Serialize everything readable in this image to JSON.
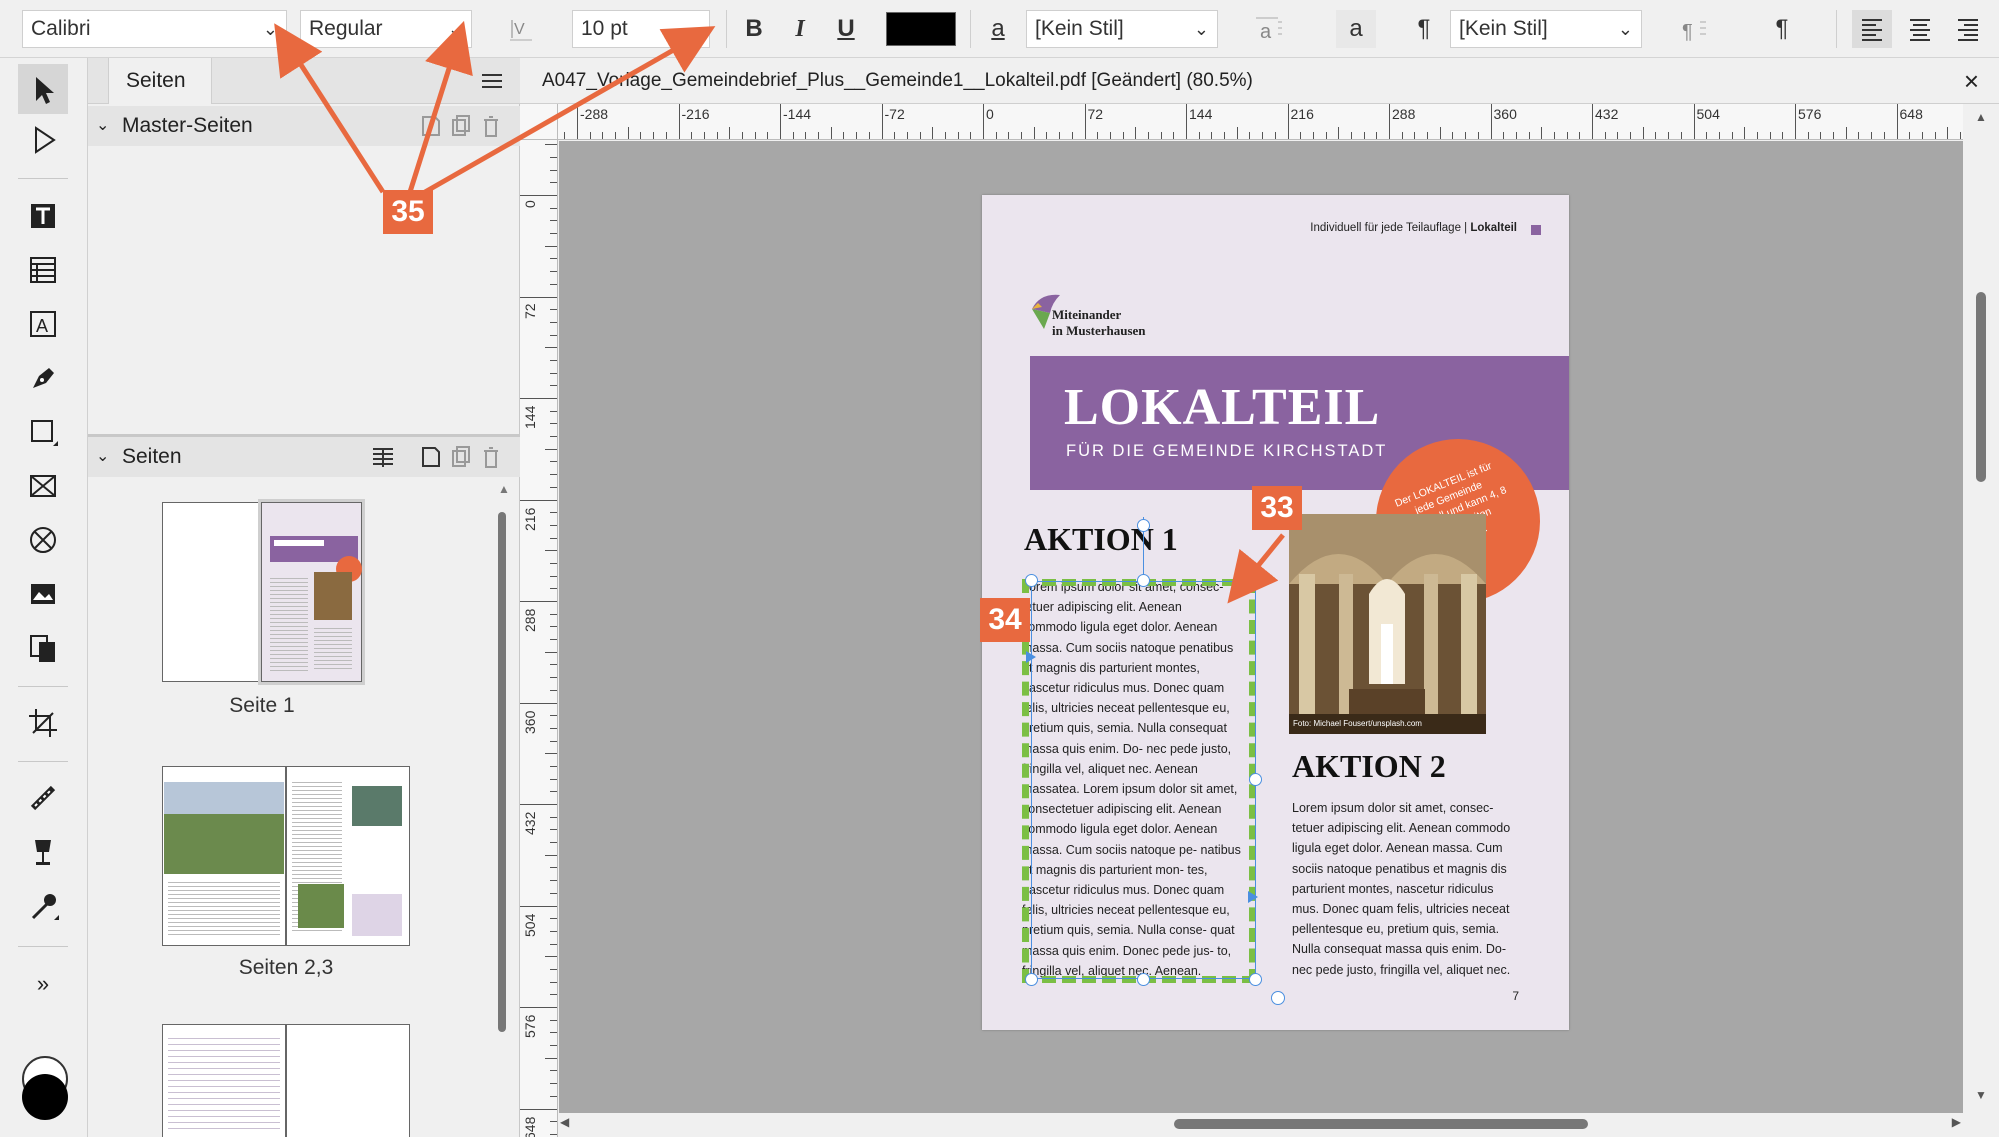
{
  "toolbar": {
    "font_family": "Calibri",
    "font_style": "Regular",
    "font_size": "10 pt",
    "bold": "B",
    "italic": "I",
    "underline": "U",
    "char_style_glyph": "a",
    "char_style": "[Kein Stil]",
    "para_style_glyph": "a",
    "pilcrow": "¶",
    "para_style": "[Kein Stil]",
    "text_color": "#000000"
  },
  "panel": {
    "tab_label": "Seiten",
    "master_section": "Master-Seiten",
    "pages_section": "Seiten",
    "thumbs": [
      {
        "label": "Seite 1"
      },
      {
        "label": "Seiten 2,3"
      }
    ]
  },
  "document": {
    "title": "A047_Vorlage_Gemeindebrief_Plus__Gemeinde1__Lokalteil.pdf [Geändert] (80.5%)",
    "close": "×"
  },
  "ruler": {
    "h_ticks": [
      "-288",
      "-216",
      "-144",
      "-72",
      "0",
      "72",
      "144",
      "216",
      "288",
      "360",
      "432",
      "504",
      "576",
      "648"
    ],
    "v_ticks": [
      "0",
      "72",
      "144",
      "216",
      "288",
      "360",
      "432",
      "504",
      "576",
      "648"
    ]
  },
  "page": {
    "header_text": "Individuell für jede Teilauflage | ",
    "header_bold": "Lokalteil",
    "logo_line1": "Miteinander",
    "logo_line2": "in Musterhausen",
    "banner_title": "LOKALTEIL",
    "banner_subtitle": "FÜR DIE GEMEINDE KIRCHSTADT",
    "circle_text": "Der LOKALTEIL ist für jede Gemeinde individuell und kann 4, 8 oder 12 Seiten umfassen.",
    "photo_credit": "Foto: Michael Fousert/unsplash.com",
    "aktion1_title": "AKTION 1",
    "aktion1_text": "Lorem ipsum dolor sit amet, consec-\ntetuer adipiscing elit. Aenean\ncommodo ligula eget dolor. Aenean\nmassa. Cum sociis natoque penatibus\net magnis dis parturient montes,\nnascetur ridiculus mus. Donec quam\nfelis, ultricies neceat pellentesque eu,\npretium quis, semia. Nulla consequat\nmassa quis enim. Do- nec pede justo,\nfringilla vel, aliquet nec. Aenean\nmassatea. Lorem ipsum dolor sit amet,\nconsectetuer adipiscing elit. Aenean\ncommodo ligula eget dolor. Aenean\nmassa. Cum sociis natoque pe- natibus\net magnis dis parturient mon- tes,\nnascetur ridiculus mus. Donec quam\nfelis, ultricies neceat pellentesque eu,\npretium quis, semia. Nulla conse- quat\nmassa quis enim. Donec pede jus- to,\nfringilla vel, aliquet nec. Aenean.",
    "aktion2_title": "AKTION 2",
    "aktion2_text": "Lorem ipsum dolor sit amet, consec-\ntetuer adipiscing elit. Aenean commodo\nligula eget dolor. Aenean massa. Cum\nsociis natoque penatibus et magnis dis\nparturient montes, nascetur ridiculus\nmus. Donec quam felis, ultricies neceat\npellentesque eu, pretium quis, semia.\nNulla consequat massa quis enim. Do-\nnec pede justo, fringilla vel, aliquet nec.",
    "page_number": "7",
    "banner_color": "#8a63a0"
  },
  "annotations": {
    "badge_33": "33",
    "badge_34": "34",
    "badge_35": "35",
    "color": "#e8693f",
    "frame_color": "#7bbf44"
  }
}
